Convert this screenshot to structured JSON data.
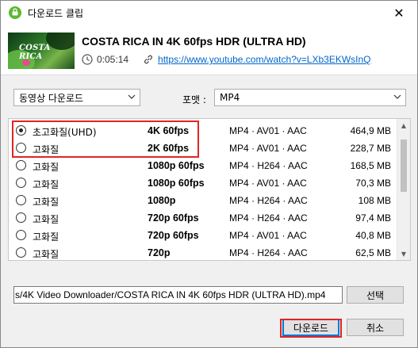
{
  "window": {
    "title": "다운로드 클립",
    "close_glyph": "✕"
  },
  "video": {
    "title": "COSTA RICA IN 4K 60fps HDR (ULTRA HD)",
    "duration": "0:05:14",
    "url": "https://www.youtube.com/watch?v=LXb3EKWsInQ",
    "thumb_text": "COSTA RICA"
  },
  "controls": {
    "mode_select": "동영상 다운로드",
    "format_label": "포맷 :",
    "format_select": "MP4"
  },
  "qualities": [
    {
      "label": "초고화질(UHD)",
      "resolution": "4K 60fps",
      "codec": "MP4 · AV01 · AAC",
      "size": "464,9 MB",
      "selected": true
    },
    {
      "label": "고화질",
      "resolution": "2K 60fps",
      "codec": "MP4 · AV01 · AAC",
      "size": "228,7 MB",
      "selected": false
    },
    {
      "label": "고화질",
      "resolution": "1080p 60fps",
      "codec": "MP4 · H264 · AAC",
      "size": "168,5 MB",
      "selected": false
    },
    {
      "label": "고화질",
      "resolution": "1080p 60fps",
      "codec": "MP4 · AV01 · AAC",
      "size": "70,3 MB",
      "selected": false
    },
    {
      "label": "고화질",
      "resolution": "1080p",
      "codec": "MP4 · H264 · AAC",
      "size": "108 MB",
      "selected": false
    },
    {
      "label": "고화질",
      "resolution": "720p 60fps",
      "codec": "MP4 · H264 · AAC",
      "size": "97,4 MB",
      "selected": false
    },
    {
      "label": "고화질",
      "resolution": "720p 60fps",
      "codec": "MP4 · AV01 · AAC",
      "size": "40,8 MB",
      "selected": false
    },
    {
      "label": "고화질",
      "resolution": "720p",
      "codec": "MP4 · H264 · AAC",
      "size": "62,5 MB",
      "selected": false
    }
  ],
  "output": {
    "path": "s/4K Video Downloader/COSTA RICA IN 4K 60fps HDR (ULTRA HD).mp4",
    "browse_label": "선택"
  },
  "buttons": {
    "download": "다운로드",
    "cancel": "취소"
  },
  "colors": {
    "accent": "#0078d7",
    "highlight": "#e02424",
    "link": "#0066cc",
    "app_icon": "#5cb82e"
  }
}
